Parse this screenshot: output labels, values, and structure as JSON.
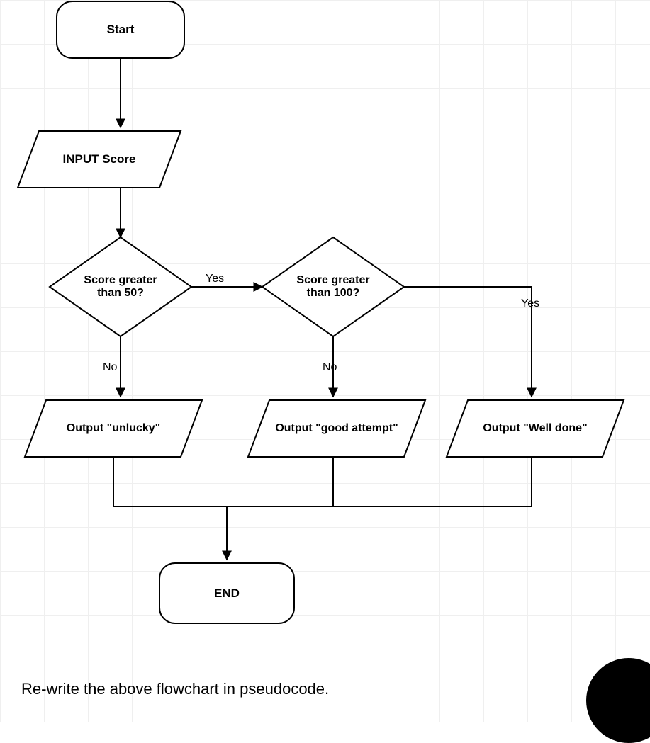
{
  "chart_data": {
    "type": "flowchart",
    "nodes": [
      {
        "id": "start",
        "kind": "terminator",
        "label": "Start"
      },
      {
        "id": "input",
        "kind": "io",
        "label": "INPUT Score"
      },
      {
        "id": "d1",
        "kind": "decision",
        "label": "Score greater than 50?"
      },
      {
        "id": "d2",
        "kind": "decision",
        "label": "Score greater than 100?"
      },
      {
        "id": "o1",
        "kind": "io",
        "label": "Output \"unlucky\""
      },
      {
        "id": "o2",
        "kind": "io",
        "label": "Output \"good attempt\""
      },
      {
        "id": "o3",
        "kind": "io",
        "label": "Output \"Well done\""
      },
      {
        "id": "end",
        "kind": "terminator",
        "label": "END"
      }
    ],
    "edges": [
      {
        "from": "start",
        "to": "input",
        "label": ""
      },
      {
        "from": "input",
        "to": "d1",
        "label": ""
      },
      {
        "from": "d1",
        "to": "d2",
        "label": "Yes"
      },
      {
        "from": "d1",
        "to": "o1",
        "label": "No"
      },
      {
        "from": "d2",
        "to": "o2",
        "label": "No"
      },
      {
        "from": "d2",
        "to": "o3",
        "label": "Yes"
      },
      {
        "from": "o1",
        "to": "end",
        "label": ""
      },
      {
        "from": "o2",
        "to": "end",
        "label": ""
      },
      {
        "from": "o3",
        "to": "end",
        "label": ""
      }
    ]
  },
  "labels": {
    "start": "Start",
    "input": "INPUT Score",
    "d1": "Score greater<br>than 50?",
    "d2": "Score greater<br>than 100?",
    "o1": "Output \"unlucky\"",
    "o2": "Output \"good attempt\"",
    "o3": "Output \"Well done\"",
    "end": "END",
    "yes": "Yes",
    "no": "No"
  },
  "question": "Re-write the above flowchart in pseudocode."
}
